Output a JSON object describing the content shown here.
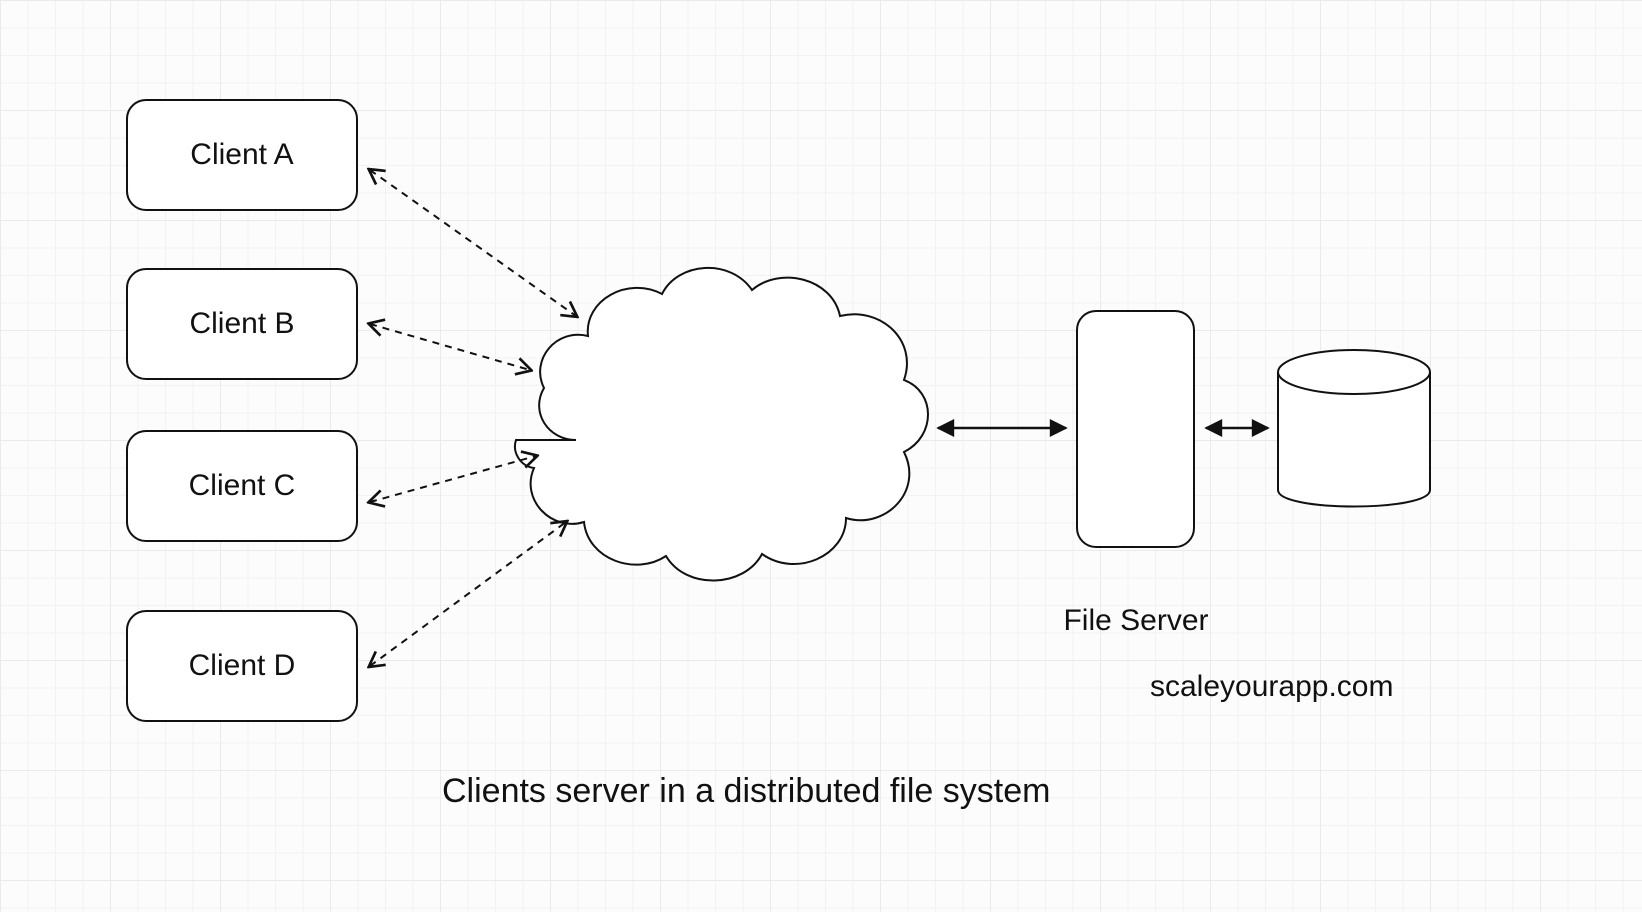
{
  "clients": [
    {
      "label": "Client A"
    },
    {
      "label": "Client B"
    },
    {
      "label": "Client C"
    },
    {
      "label": "Client D"
    }
  ],
  "network": {
    "label": "Network"
  },
  "server": {
    "label": "File Server"
  },
  "disk": {
    "label": "Disk"
  },
  "caption": "Clients server in a distributed file system",
  "watermark": "scaleyourapp.com"
}
